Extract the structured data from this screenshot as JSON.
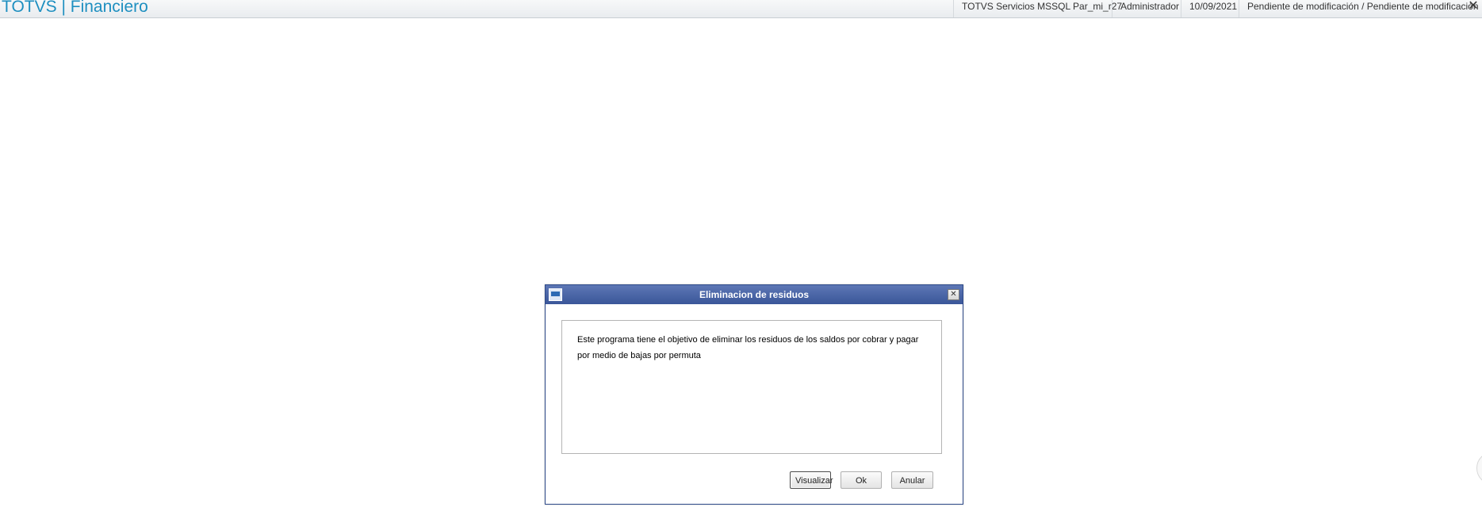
{
  "header": {
    "app_title": "TOTVS | Financiero",
    "environment": "TOTVS Servicios MSSQL Par_mi_r27",
    "user": "Administrador",
    "date": "10/09/2021",
    "status": "Pendiente de modificación / Pendiente de modificación",
    "close_icon": "close-icon"
  },
  "dialog": {
    "title": "Eliminacion de residuos",
    "window_icon": "window-icon",
    "close_icon": "close-icon",
    "message_line1": "Este programa tiene el objetivo de eliminar los residuos de los saldos por cobrar y pagar",
    "message_line2": "por medio de bajas por permuta",
    "buttons": {
      "visualizar": "Visualizar",
      "ok": "Ok",
      "anular": "Anular"
    }
  },
  "colors": {
    "brand": "#1e8fc0",
    "dialog_titlebar": "#3a5699"
  }
}
